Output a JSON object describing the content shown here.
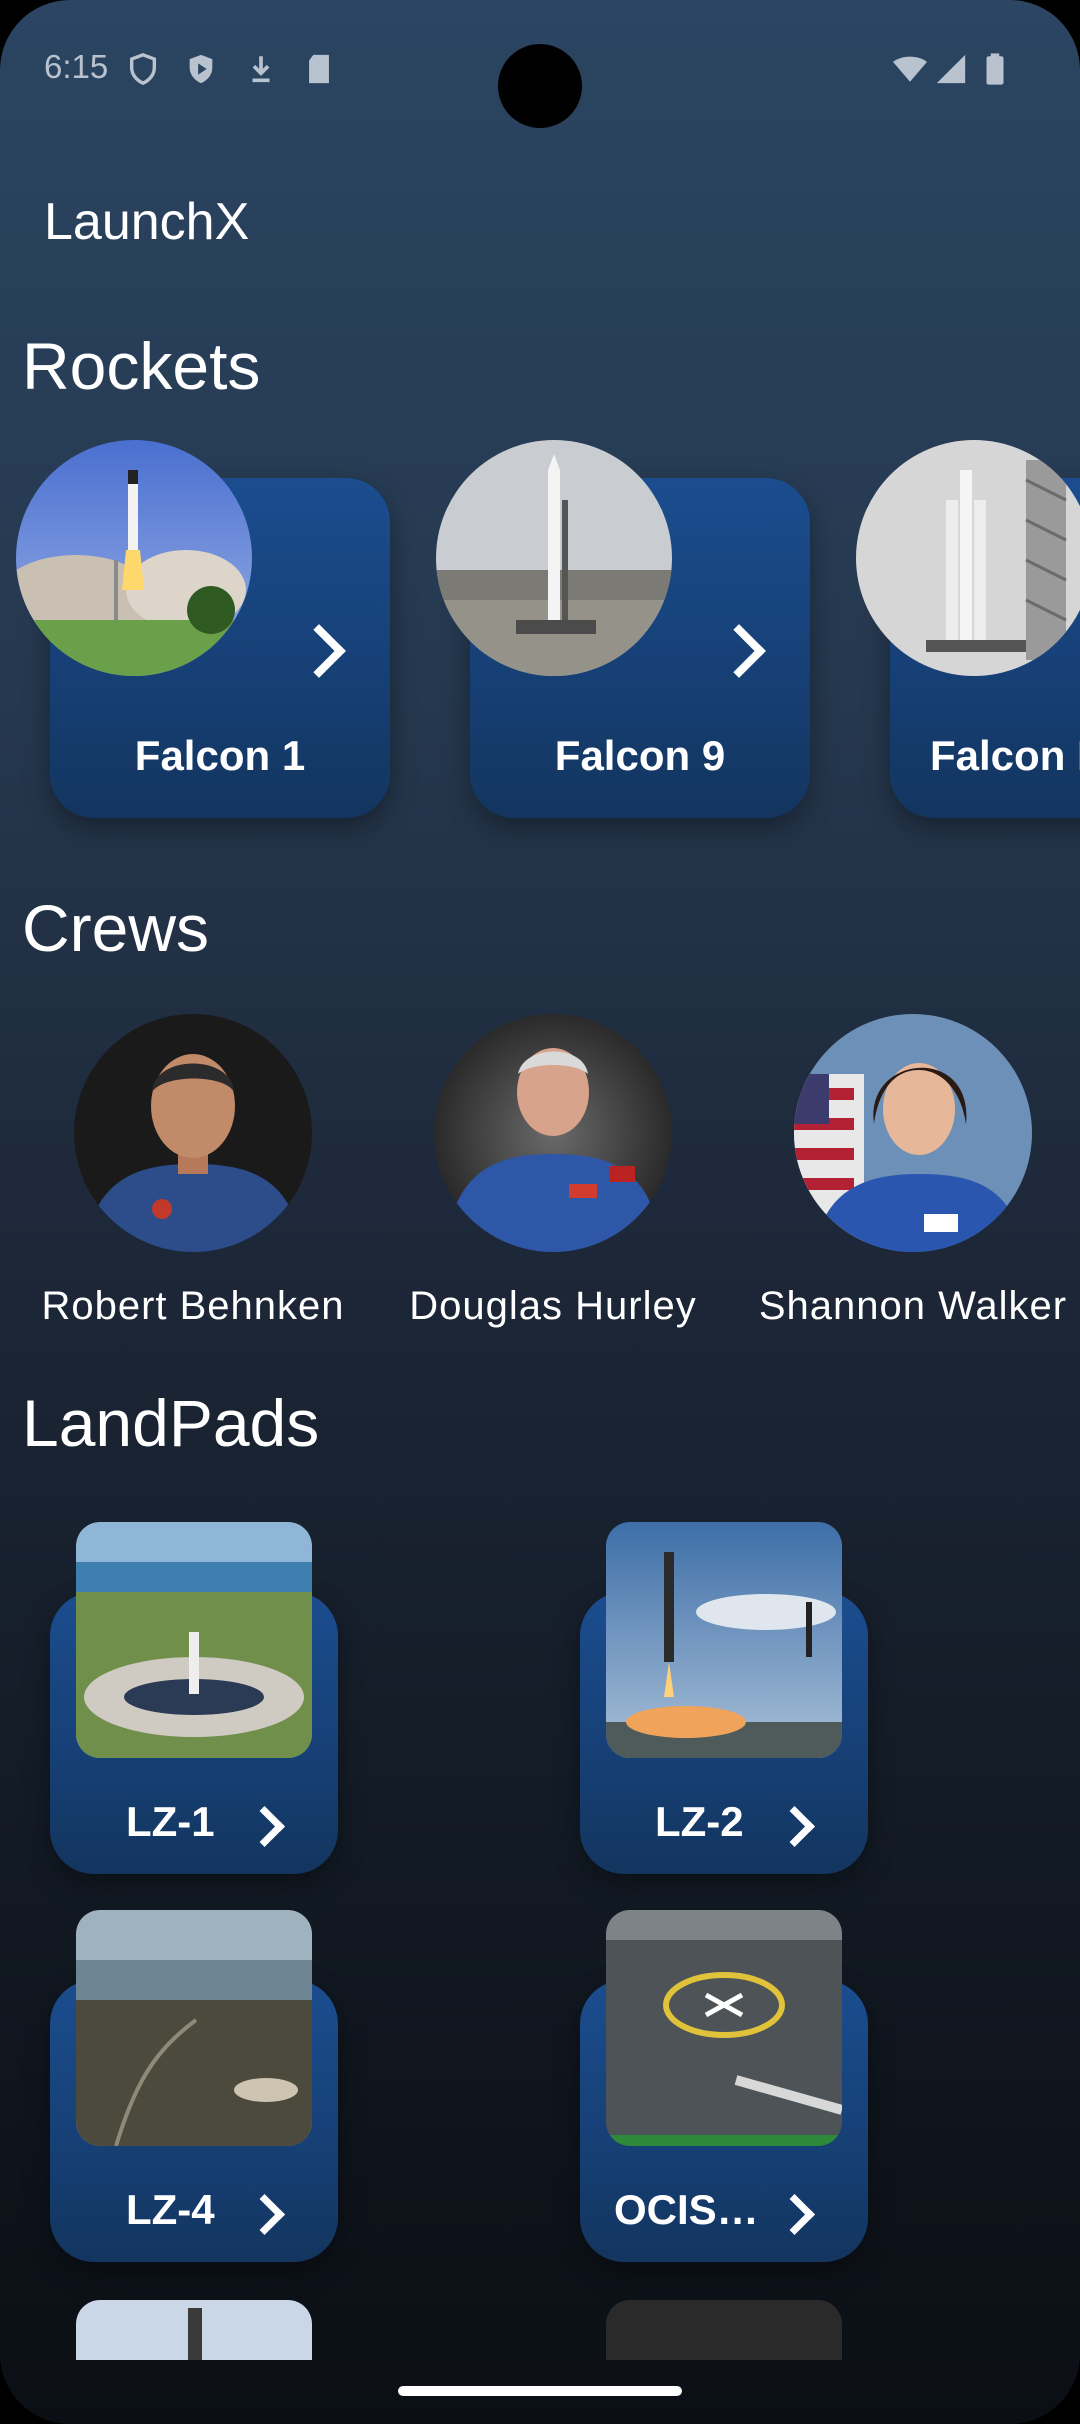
{
  "status_bar": {
    "time": "6:15"
  },
  "app": {
    "title": "LaunchX"
  },
  "sections": {
    "rockets": "Rockets",
    "crews": "Crews",
    "landpads": "LandPads"
  },
  "rockets": [
    {
      "name": "Falcon 1"
    },
    {
      "name": "Falcon 9"
    },
    {
      "name": "Falcon Heavy"
    }
  ],
  "crews": [
    {
      "name": "Robert Behnken"
    },
    {
      "name": "Douglas Hurley"
    },
    {
      "name": "Shannon Walker"
    }
  ],
  "landpads": [
    {
      "name": "LZ-1"
    },
    {
      "name": "LZ-2"
    },
    {
      "name": "LZ-4"
    },
    {
      "name": "OCIS…"
    }
  ],
  "colors": {
    "card": "#1b4d8f",
    "background_top": "#2b4562",
    "background_bottom": "#0b0f15"
  }
}
